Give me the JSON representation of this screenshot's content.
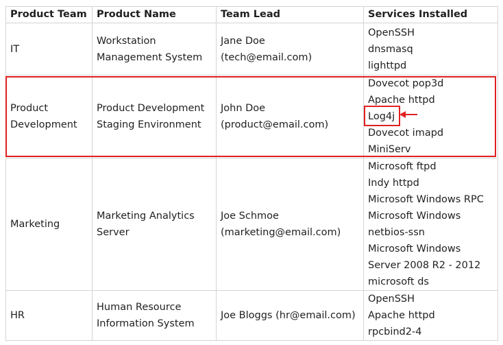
{
  "table": {
    "headers": [
      "Product Team",
      "Product Name",
      "Team Lead",
      "Services Installed"
    ],
    "rows": [
      {
        "team": "IT",
        "product": [
          "Workstation",
          "Management System"
        ],
        "lead": [
          "Jane Doe",
          "(tech@email.com)"
        ],
        "services": [
          "OpenSSH",
          "dnsmasq",
          "lighttpd"
        ]
      },
      {
        "team": [
          "Product",
          "Development"
        ],
        "product": [
          "Product Development",
          "Staging Environment"
        ],
        "lead": [
          "John Doe",
          "(product@email.com)"
        ],
        "services": [
          "Dovecot pop3d",
          "Apache httpd",
          "Log4j",
          "Dovecot imapd",
          "MiniServ"
        ]
      },
      {
        "team": "Marketing",
        "product": [
          "Marketing Analytics",
          "Server"
        ],
        "lead": [
          "Joe Schmoe",
          "(marketing@email.com)"
        ],
        "services": [
          "Microsoft ftpd",
          "Indy httpd",
          "Microsoft Windows RPC",
          "Microsoft Windows",
          "netbios-ssn",
          "Microsoft Windows",
          "Server 2008 R2 - 2012",
          "microsoft ds"
        ]
      },
      {
        "team": "HR",
        "product": [
          "Human Resource",
          "Information System"
        ],
        "lead": "Joe Bloggs (hr@email.com)",
        "services": [
          "OpenSSH",
          "Apache httpd",
          "rpcbind2-4"
        ]
      }
    ]
  },
  "annotations": {
    "highlight_color": "#e02020"
  }
}
